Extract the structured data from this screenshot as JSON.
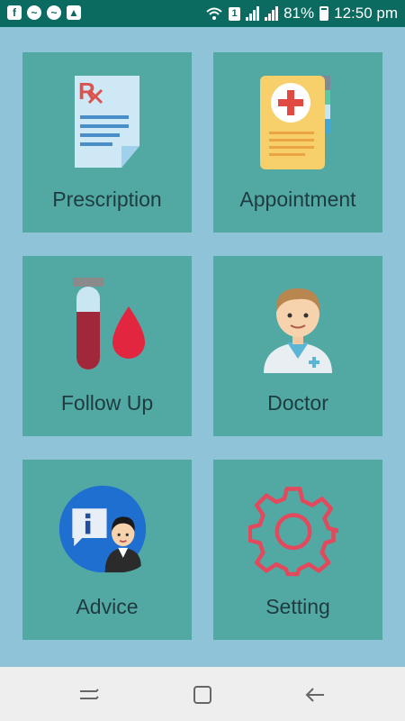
{
  "status_bar": {
    "notification_icons": [
      "facebook-icon",
      "messenger-icon",
      "messenger-icon",
      "gallery-icon"
    ],
    "sim_label": "1",
    "battery_percent": "81%",
    "time": "12:50 pm"
  },
  "tiles": [
    {
      "label": "Prescription",
      "icon": "prescription-icon"
    },
    {
      "label": "Appointment",
      "icon": "appointment-icon"
    },
    {
      "label": "Follow Up",
      "icon": "blood-test-icon"
    },
    {
      "label": "Doctor",
      "icon": "doctor-icon"
    },
    {
      "label": "Advice",
      "icon": "advice-icon"
    },
    {
      "label": "Setting",
      "icon": "gear-icon"
    }
  ],
  "nav_bar": {
    "buttons": [
      "recent-apps-icon",
      "home-icon",
      "back-icon"
    ]
  },
  "colors": {
    "background": "#8ec3d8",
    "tile": "#52a9a4",
    "status_bar": "#0b6b60",
    "label_text": "#1f3b3f"
  }
}
